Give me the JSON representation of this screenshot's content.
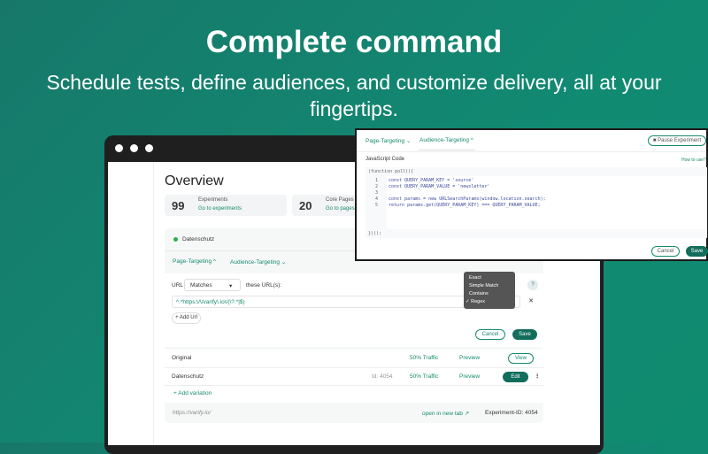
{
  "hero": {
    "title": "Complete command",
    "subtitle": "Schedule tests, define audiences, and customize delivery, all at your fingertips."
  },
  "overview": {
    "title": "Overview",
    "stats": [
      {
        "value": "99",
        "label": "Experiments",
        "link": "Go to experiments"
      },
      {
        "value": "20",
        "label": "Core Pages",
        "link": "Go to pages"
      }
    ]
  },
  "experiment": {
    "name": "Datenschutz",
    "tabs": [
      "Page-Targeting ^",
      "Audience-Targeting ⌄"
    ],
    "pause": "Pause Experiment",
    "url_label": "URL",
    "match": "Matches",
    "these": "these URL(s):",
    "url_value": "^.*https:\\/\\/varify\\.io\\/(\\?.*|$)",
    "add_url": "+ Add Url",
    "help": "?",
    "remove": "✕",
    "options": [
      "Exact",
      "Simple Match",
      "Contains",
      "✓ Regex"
    ],
    "cancel": "Cancel",
    "save": "Save",
    "variations": [
      {
        "name": "Original",
        "traffic": "50% Traffic",
        "preview": "Preview",
        "action": "View"
      },
      {
        "name": "Datenschutz",
        "id": "Id: 4054",
        "traffic": "50% Traffic",
        "preview": "Preview",
        "action": "Edit"
      }
    ],
    "add_variation": "+ Add variation",
    "footer_url": "https://varify.io/",
    "open_new": "open in new tab ↗",
    "exp_id": "Experiment-ID: 4054"
  },
  "popup": {
    "tabs": [
      "Page-Targeting ⌄",
      "Audience-Targeting ^"
    ],
    "pause": "■ Pause Experiment",
    "section": "JavaScript Code",
    "howto": "How to use?",
    "code_open": "(function poll(){",
    "lines": [
      "const QUERY_PARAM_KEY = 'source'",
      "const QUERY_PARAM_VALUE = 'newsletter'",
      "",
      "const params = new URLSearchParams(window.location.search);",
      "return params.get(QUERY_PARAM_KEY) === QUERY_PARAM_VALUE;"
    ],
    "line_nums": [
      "1",
      "2",
      "3",
      "4",
      "5"
    ],
    "code_close": "})();",
    "cancel": "Cancel",
    "save": "Save"
  }
}
